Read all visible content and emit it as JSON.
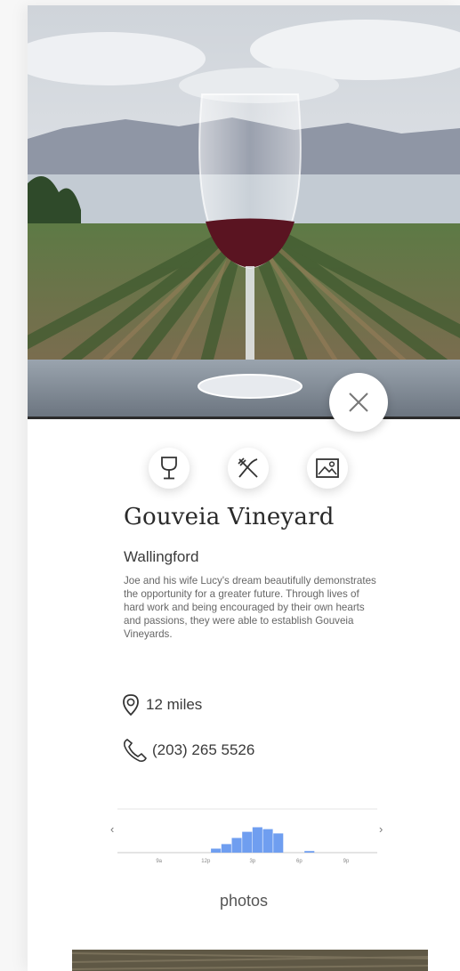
{
  "venue": {
    "name": "Gouveia Vineyard",
    "town": "Wallingford",
    "description": "Joe and his wife Lucy's dream beautifully demonstrates the opportunity for a greater future. Through lives of hard work and being encouraged by their own hearts and passions, they were able to establish Gouveia Vineyards.",
    "distance": "12 miles",
    "phone": "(203) 265 5526"
  },
  "icons": {
    "close": "close-icon",
    "wine": "wine-glass-icon",
    "food": "fork-knife-icon",
    "gallery": "image-icon",
    "location": "map-pin-icon",
    "phone": "phone-icon"
  },
  "popular_times": {
    "prev": "‹",
    "next": "›",
    "tick_labels": [
      "9a",
      "12p",
      "3p",
      "6p",
      "9p"
    ],
    "bar_color": "#6f9ef0",
    "bars": [
      0,
      0,
      0,
      0,
      0,
      0,
      0,
      0,
      0,
      0.15,
      0.32,
      0.55,
      0.78,
      0.95,
      0.88,
      0.72,
      0,
      0,
      0.06,
      0,
      0,
      0,
      0,
      0,
      0
    ]
  },
  "photos": {
    "label": "photos"
  }
}
